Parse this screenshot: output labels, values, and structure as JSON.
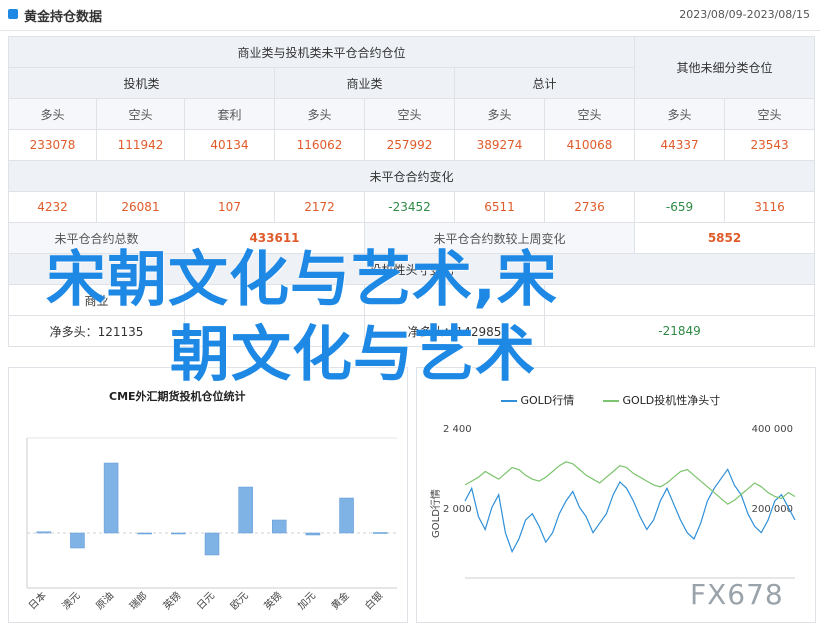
{
  "header": {
    "title": "黄金持仓数据",
    "date_range": "2023/08/09-2023/08/15"
  },
  "table": {
    "group_title": "商业类与投机类未平仓合约仓位",
    "other_title": "其他未细分类仓位",
    "cat_speculative": "投机类",
    "cat_commercial": "商业类",
    "cat_total": "总计",
    "col_long": "多头",
    "col_short": "空头",
    "col_spread": "套利",
    "values": [
      "233078",
      "111942",
      "40134",
      "116062",
      "257992",
      "389274",
      "410068",
      "44337",
      "23543"
    ],
    "change_title": "未平仓合约变化",
    "changes": [
      "4232",
      "26081",
      "107",
      "2172",
      "-23452",
      "6511",
      "2736",
      "-659",
      "3116"
    ],
    "oi_total_label": "未平仓合约总数",
    "oi_total_value": "433611",
    "oi_change_label": "未平仓合约数较上周变化",
    "oi_change_value": "5852",
    "row9_title": "投机性头寸变化",
    "row10": [
      "商业",
      "",
      "",
      "",
      "-21849"
    ],
    "net_long_1": "净多头：121135",
    "net_long_2": "净多头：142985"
  },
  "watermark": {
    "line1": "宋朝文化与艺术,宋",
    "line2": "朝文化与艺术",
    "corner": "FX678"
  },
  "chart_data": [
    {
      "type": "bar",
      "title": "CME外汇期货投机仓位统计",
      "categories": [
        "日本",
        "澳元",
        "原油",
        "瑞郎",
        "英镑",
        "日元",
        "欧元",
        "英镑",
        "加元",
        "黄金",
        "白银"
      ],
      "values": [
        1.2,
        -15,
        70,
        -0.5,
        -0.3,
        -22,
        46,
        13,
        -2,
        35,
        0.5
      ],
      "ylim": [
        -55,
        95
      ],
      "colors": {
        "bar": "#7fb3e6",
        "bar_border": "#5b97d6"
      }
    },
    {
      "type": "line",
      "legend": [
        "GOLD行情",
        "GOLD投机性净头寸"
      ],
      "ylabel": "GOLD行情",
      "y_ticks_left": [
        "2 400",
        "2 000"
      ],
      "y_ticks_right": [
        "400 000",
        "200 000"
      ],
      "series": [
        {
          "name": "GOLD行情",
          "color": "#2f8fd8",
          "values": [
            2010,
            1990,
            2035,
            2055,
            2020,
            2000,
            2060,
            2090,
            2070,
            2040,
            2030,
            2050,
            2075,
            2060,
            2030,
            2010,
            1995,
            2020,
            2035,
            2060,
            2045,
            2030,
            2000,
            1980,
            1990,
            2010,
            2035,
            2055,
            2040,
            2010,
            1990,
            2015,
            2040,
            2060,
            2070,
            2045,
            2010,
            1990,
            1975,
            1960,
            1985,
            2000,
            2030,
            2050,
            2060,
            2040,
            2010,
            2000,
            2020,
            2040
          ]
        },
        {
          "name": "GOLD投机性净头寸",
          "color": "#7cc46d",
          "values": [
            230000,
            240000,
            250000,
            265000,
            255000,
            245000,
            260000,
            275000,
            270000,
            255000,
            245000,
            240000,
            250000,
            265000,
            280000,
            290000,
            285000,
            270000,
            255000,
            245000,
            235000,
            250000,
            265000,
            280000,
            275000,
            260000,
            250000,
            240000,
            230000,
            225000,
            235000,
            250000,
            265000,
            270000,
            255000,
            240000,
            225000,
            210000,
            195000,
            180000,
            190000,
            205000,
            220000,
            235000,
            225000,
            210000,
            200000,
            195000,
            210000,
            200000
          ]
        }
      ]
    }
  ]
}
